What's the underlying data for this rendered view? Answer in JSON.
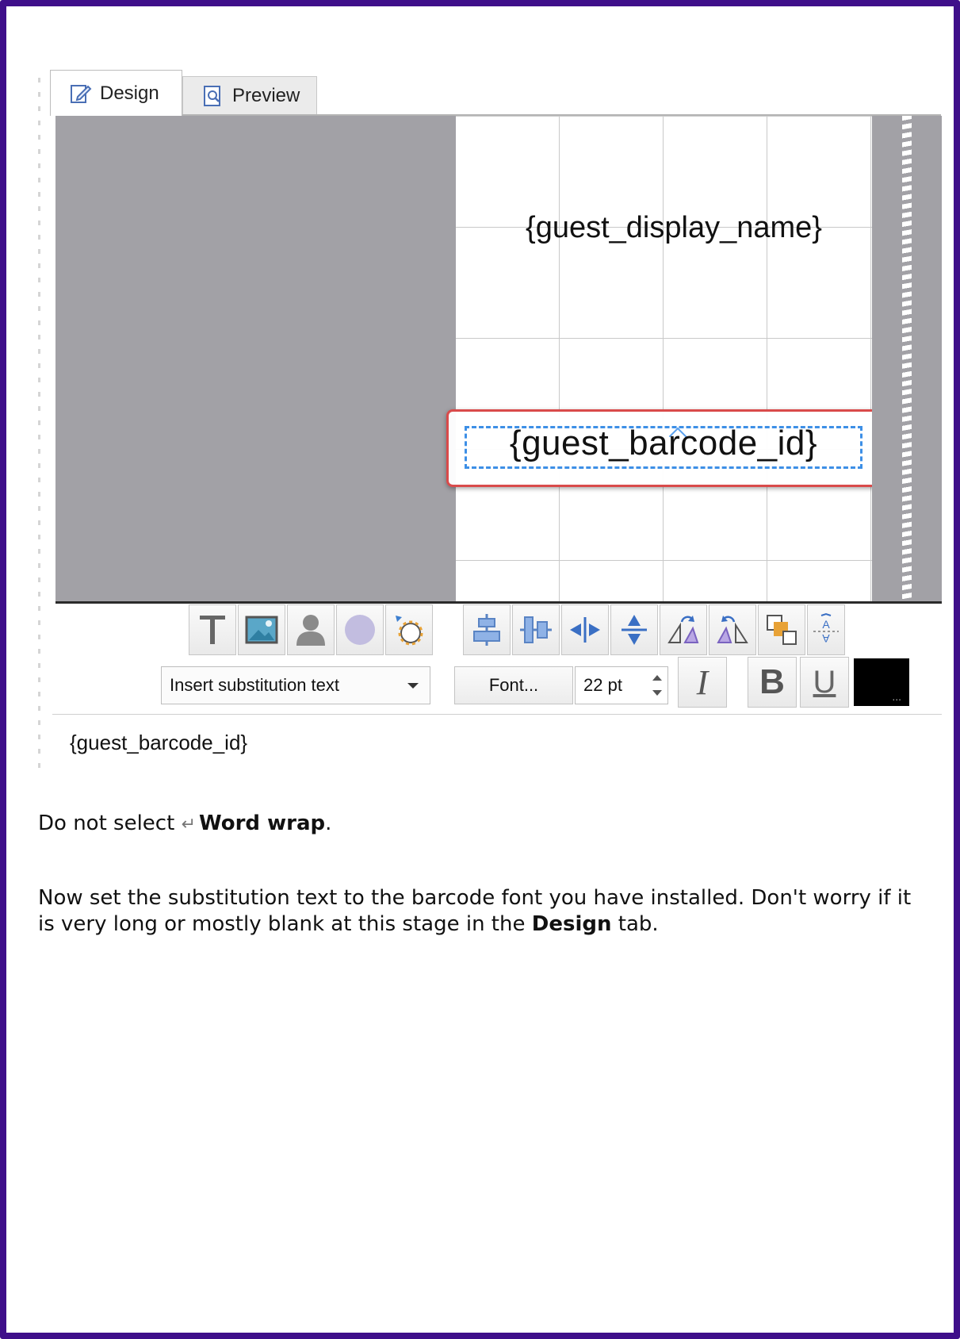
{
  "tabs": {
    "design": "Design",
    "preview": "Preview"
  },
  "canvas": {
    "name_placeholder": "{guest_display_name}",
    "barcode_placeholder": "{guest_barcode_id}"
  },
  "toolbar": {
    "insert_dropdown": "Insert substitution text",
    "font_button": "Font...",
    "font_size": "22 pt",
    "color_button": "...",
    "italic": "I",
    "bold": "B",
    "underline": "U"
  },
  "substitution_field": {
    "value": "{guest_barcode_id}"
  },
  "instructions": {
    "p1_prefix": "Do not select ",
    "p1_bold": "Word wrap",
    "p1_suffix": ".",
    "p2_text": "Now set the substitution text to the barcode font you have installed. Don't worry if it is very long or mostly blank at this stage in the ",
    "p2_bold": "Design",
    "p2_suffix": " tab."
  },
  "colors": {
    "frame_border": "#3f0f8a",
    "selection_outline": "#d94b4b",
    "selection_dashed": "#3d8fe6",
    "canvas_gray": "#a2a1a6"
  }
}
